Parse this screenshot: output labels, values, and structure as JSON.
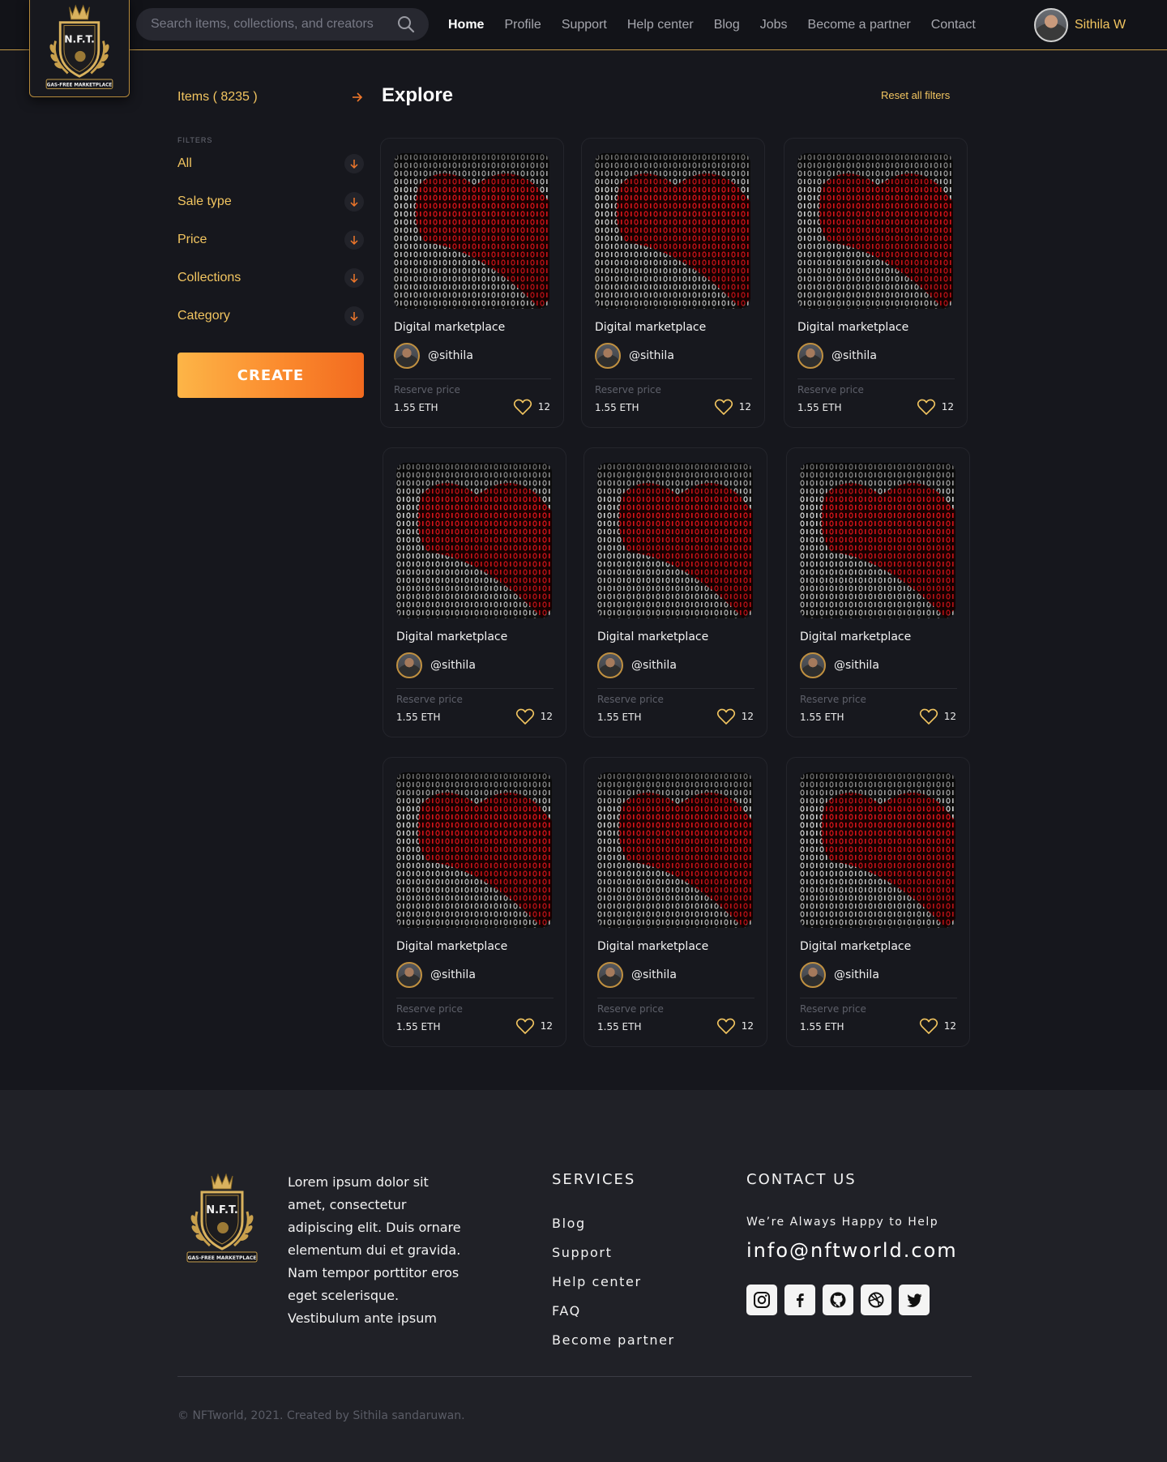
{
  "header": {
    "logo_text": "N.F.T.",
    "logo_subtext": "GAS-FREE MARKETPLACE",
    "search_placeholder": "Search items, collections, and creators",
    "nav": [
      {
        "label": "Home",
        "active": true
      },
      {
        "label": "Profile",
        "active": false
      },
      {
        "label": "Support",
        "active": false
      },
      {
        "label": "Help center",
        "active": false
      },
      {
        "label": "Blog",
        "active": false
      },
      {
        "label": "Jobs",
        "active": false
      },
      {
        "label": "Become a partner",
        "active": false
      },
      {
        "label": "Contact",
        "active": false
      }
    ],
    "user_name": "Sithila W"
  },
  "sidebar": {
    "items_label": "Items ( 8235 )",
    "filters_label": "FILTERS",
    "filters": [
      "All",
      "Sale type",
      "Price",
      "Collections",
      "Category"
    ],
    "create_label": "CREATE"
  },
  "explore": {
    "title": "Explore",
    "reset_label": "Reset all filters"
  },
  "cards": [
    {
      "title": "Digital marketplace",
      "owner": "@sithila",
      "price_label": "Reserve price",
      "price": "1.55 ETH",
      "likes": "12"
    },
    {
      "title": "Digital marketplace",
      "owner": "@sithila",
      "price_label": "Reserve price",
      "price": "1.55 ETH",
      "likes": "12"
    },
    {
      "title": "Digital marketplace",
      "owner": "@sithila",
      "price_label": "Reserve price",
      "price": "1.55 ETH",
      "likes": "12"
    },
    {
      "title": "Digital marketplace",
      "owner": "@sithila",
      "price_label": "Reserve price",
      "price": "1.55 ETH",
      "likes": "12"
    },
    {
      "title": "Digital marketplace",
      "owner": "@sithila",
      "price_label": "Reserve price",
      "price": "1.55 ETH",
      "likes": "12"
    },
    {
      "title": "Digital marketplace",
      "owner": "@sithila",
      "price_label": "Reserve price",
      "price": "1.55 ETH",
      "likes": "12"
    },
    {
      "title": "Digital marketplace",
      "owner": "@sithila",
      "price_label": "Reserve price",
      "price": "1.55 ETH",
      "likes": "12"
    },
    {
      "title": "Digital marketplace",
      "owner": "@sithila",
      "price_label": "Reserve price",
      "price": "1.55 ETH",
      "likes": "12"
    },
    {
      "title": "Digital marketplace",
      "owner": "@sithila",
      "price_label": "Reserve price",
      "price": "1.55 ETH",
      "likes": "12"
    }
  ],
  "footer": {
    "about": "Lorem ipsum dolor sit amet, consectetur adipiscing elit. Duis ornare elementum dui et gravida. Nam tempor porttitor eros eget scelerisque. Vestibulum ante ipsum",
    "services_title": "SERVICES",
    "services": [
      "Blog",
      "Support",
      "Help center",
      "FAQ",
      "Become partner"
    ],
    "contact_title": "CONTACT US",
    "tagline": "We’re Always Happy to Help",
    "email": "info@nftworld.com",
    "socials": [
      "instagram-icon",
      "facebook-icon",
      "github-icon",
      "dribbble-icon",
      "twitter-icon"
    ],
    "copyright": "© NFTworld, 2021. Created by Sithila sandaruwan."
  },
  "colors": {
    "accent": "#f2c560",
    "create_gradient_start": "#fdb547",
    "create_gradient_end": "#f26a1f",
    "background": "#16171d",
    "footer_background": "#202127"
  }
}
